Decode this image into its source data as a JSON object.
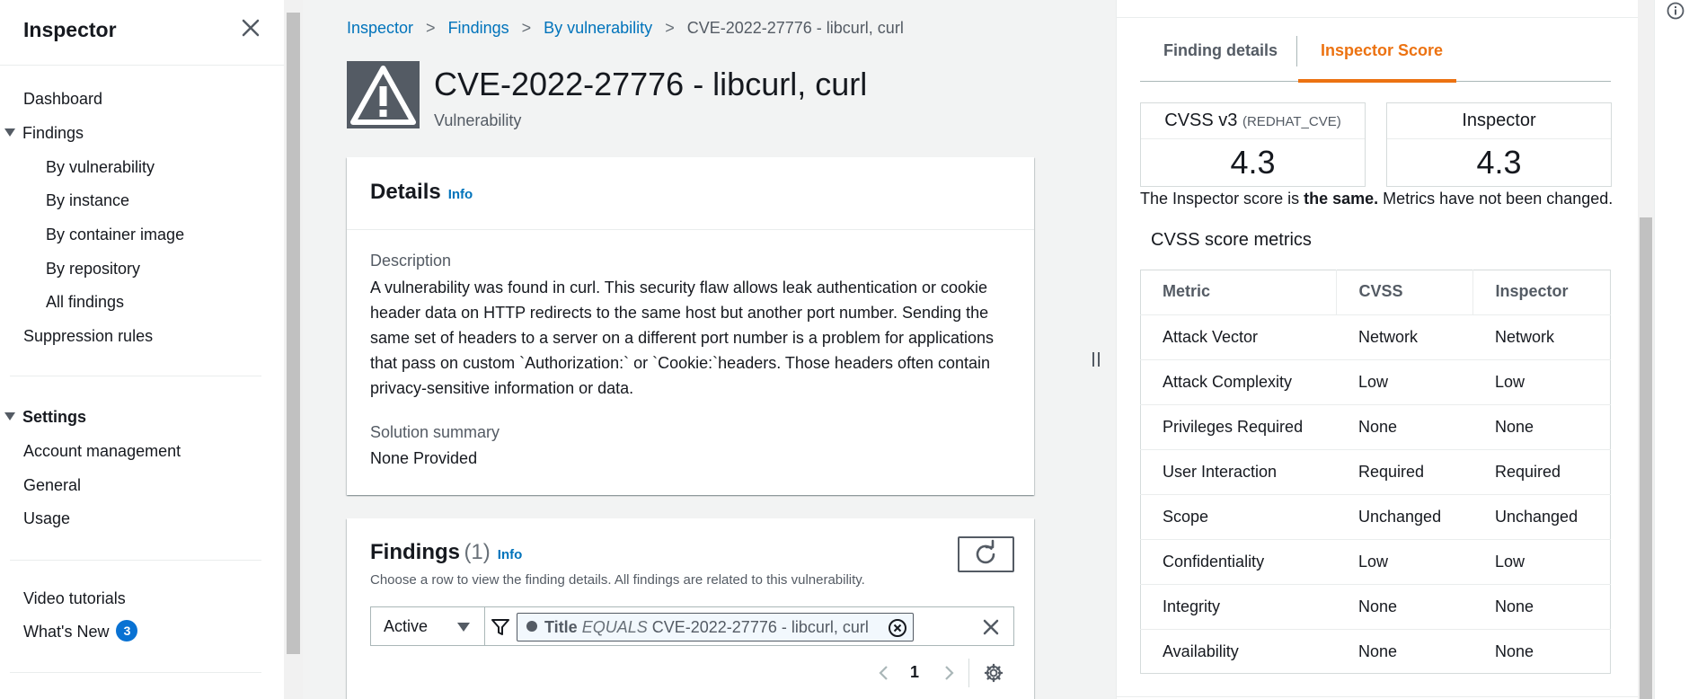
{
  "sidebar": {
    "title": "Inspector",
    "items": {
      "dashboard": "Dashboard",
      "findings": "Findings",
      "by_vulnerability": "By vulnerability",
      "by_instance": "By instance",
      "by_container_image": "By container image",
      "by_repository": "By repository",
      "all_findings": "All findings",
      "suppression_rules": "Suppression rules",
      "settings": "Settings",
      "account_management": "Account management",
      "general": "General",
      "usage": "Usage",
      "video_tutorials": "Video tutorials",
      "whats_new": "What's New",
      "whats_new_count": "3"
    }
  },
  "breadcrumb": {
    "items": [
      "Inspector",
      "Findings",
      "By vulnerability"
    ],
    "current": "CVE-2022-27776 - libcurl, curl"
  },
  "header": {
    "title": "CVE-2022-27776 - libcurl, curl",
    "subtitle": "Vulnerability"
  },
  "details": {
    "heading": "Details",
    "info": "Info",
    "description_label": "Description",
    "description": "A vulnerability was found in curl. This security flaw allows leak authentication or cookie header data on HTTP redirects to the same host but another port number. Sending the same set of headers to a server on a different port number is a problem for applications that pass on custom `Authorization:` or `Cookie:`headers. Those headers often contain privacy-sensitive information or data.",
    "solution_label": "Solution summary",
    "solution": "None Provided"
  },
  "findings": {
    "heading": "Findings",
    "count": "(1)",
    "info": "Info",
    "description": "Choose a row to view the finding details. All findings are related to this vulnerability.",
    "status": "Active",
    "filter_key": "Title",
    "filter_op": "EQUALS",
    "filter_value": "CVE-2022-27776 - libcurl, curl",
    "page": "1"
  },
  "panel": {
    "tabs": [
      "Finding details",
      "Inspector Score"
    ],
    "active_tab": "Inspector Score",
    "cvss_title": "CVSS v3",
    "cvss_source": "(REDHAT_CVE)",
    "cvss_score": "4.3",
    "inspector_title": "Inspector",
    "inspector_score": "4.3",
    "note_pre": "The Inspector score is ",
    "note_bold": "the same.",
    "note_post": " Metrics have not been changed.",
    "metrics_heading": "CVSS score metrics",
    "columns": [
      "Metric",
      "CVSS",
      "Inspector"
    ],
    "rows": [
      [
        "Attack Vector",
        "Network",
        "Network"
      ],
      [
        "Attack Complexity",
        "Low",
        "Low"
      ],
      [
        "Privileges Required",
        "None",
        "None"
      ],
      [
        "User Interaction",
        "Required",
        "Required"
      ],
      [
        "Scope",
        "Unchanged",
        "Unchanged"
      ],
      [
        "Confidentiality",
        "Low",
        "Low"
      ],
      [
        "Integrity",
        "None",
        "None"
      ],
      [
        "Availability",
        "None",
        "None"
      ]
    ]
  },
  "colors": {
    "link": "#0073bb",
    "accent": "#ec7211",
    "badge": "#0972d3"
  }
}
